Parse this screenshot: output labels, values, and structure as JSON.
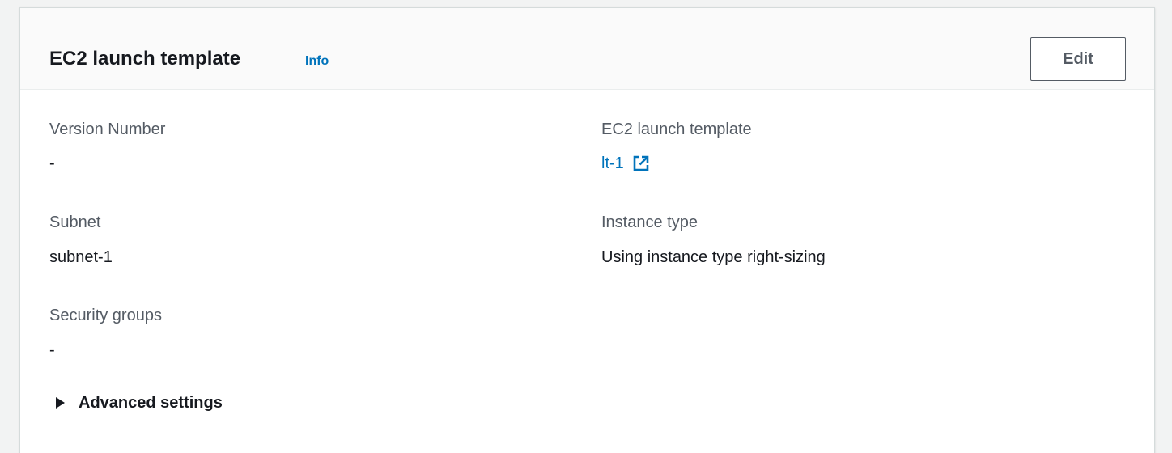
{
  "panel": {
    "title": "EC2 launch template",
    "info_label": "Info",
    "edit_label": "Edit"
  },
  "left_column": {
    "version_number": {
      "label": "Version Number",
      "value": "-"
    },
    "subnet": {
      "label": "Subnet",
      "value": "subnet-1"
    },
    "security_groups": {
      "label": "Security groups",
      "value": "-"
    }
  },
  "right_column": {
    "launch_template": {
      "label": "EC2 launch template",
      "value": "lt-1",
      "icon": "external-link-icon"
    },
    "instance_type": {
      "label": "Instance type",
      "value": "Using instance type right-sizing"
    }
  },
  "advanced": {
    "label": "Advanced settings",
    "icon": "caret-right-icon",
    "expanded": false
  },
  "colors": {
    "link": "#0073bb",
    "label": "#545b64",
    "text": "#16191f",
    "background": "#f2f3f3"
  }
}
